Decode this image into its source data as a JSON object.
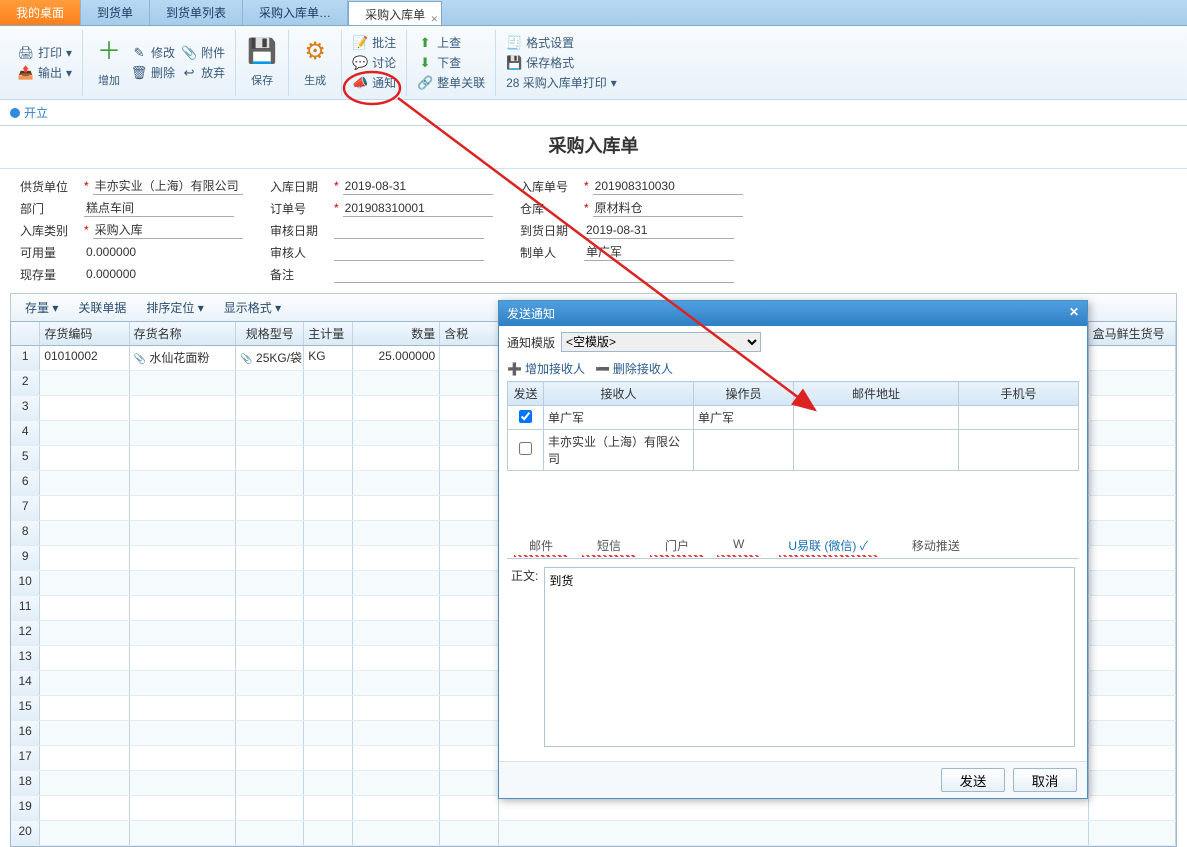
{
  "tabs": [
    "我的桌面",
    "到货单",
    "到货单列表",
    "采购入库单…",
    "采购入库单"
  ],
  "activeTab": 4,
  "ribbon": {
    "print": "打印",
    "output": "输出",
    "add": "增加",
    "modify": "修改",
    "delete": "删除",
    "attachment": "附件",
    "abandon": "放弃",
    "save": "保存",
    "generate": "生成",
    "approve": "批注",
    "discuss": "讨论",
    "notify": "通知",
    "up": "上查",
    "down": "下查",
    "whole": "整单关联",
    "format": "格式设置",
    "saveFormat": "保存格式",
    "label28": "28 采购入库单打印"
  },
  "status": "开立",
  "pageTitle": "采购入库单",
  "form": {
    "supplierLbl": "供货单位",
    "supplier": "丰亦实业（上海）有限公司",
    "inDateLbl": "入库日期",
    "inDate": "2019-08-31",
    "inNoLbl": "入库单号",
    "inNo": "201908310030",
    "deptLbl": "部门",
    "dept": "糕点车间",
    "orderNoLbl": "订单号",
    "orderNo": "201908310001",
    "whLbl": "仓库",
    "wh": "原材料仓",
    "inTypeLbl": "入库类别",
    "inType": "采购入库",
    "auditDateLbl": "审核日期",
    "auditDate": "",
    "arriveDateLbl": "到货日期",
    "arriveDate": "2019-08-31",
    "availLbl": "可用量",
    "avail": "0.000000",
    "auditorLbl": "审核人",
    "auditor": "",
    "makerLbl": "制单人",
    "maker": "单广军",
    "stockLbl": "现存量",
    "stock": "0.000000",
    "remarkLbl": "备注",
    "remark": ""
  },
  "gridToolbar": {
    "stock": "存量",
    "relate": "关联单据",
    "sort": "排序定位",
    "display": "显示格式"
  },
  "gridHeaders": {
    "code": "存货编码",
    "name": "存货名称",
    "spec": "规格型号",
    "unit": "主计量",
    "qty": "数量",
    "tax": "含税",
    "hema": "盒马鲜生货号"
  },
  "gridRow": {
    "code": "01010002",
    "name": "水仙花面粉",
    "spec": "25KG/袋",
    "unit": "KG",
    "qty": "25.000000"
  },
  "dialog": {
    "title": "发送通知",
    "tplLbl": "通知模版",
    "tpl": "<空模版>",
    "addRecip": "增加接收人",
    "delRecip": "删除接收人",
    "cols": {
      "send": "发送",
      "recip": "接收人",
      "op": "操作员",
      "mail": "邮件地址",
      "phone": "手机号"
    },
    "rows": [
      {
        "send": true,
        "recip": "单广军",
        "op": "单广军",
        "mail": "",
        "phone": ""
      },
      {
        "send": false,
        "recip": "丰亦实业（上海）有限公司",
        "op": "",
        "mail": "",
        "phone": ""
      }
    ],
    "subtabs": {
      "mail": "邮件",
      "sms": "短信",
      "portal": "门户",
      "w": "W",
      "yilian": "U易联 (微信) ✓",
      "push": "移动推送"
    },
    "bodyLbl": "正文:",
    "body": "到货",
    "send": "发送",
    "cancel": "取消"
  }
}
